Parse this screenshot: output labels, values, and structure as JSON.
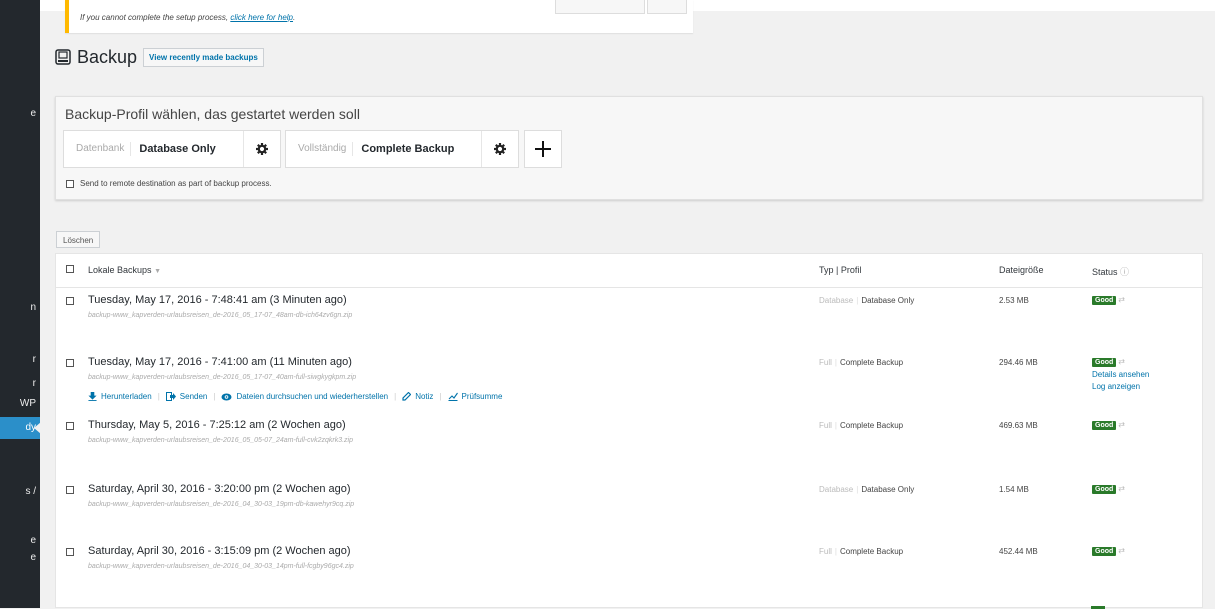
{
  "sidebar": {
    "visible_fragments": [
      "e",
      "n",
      "r",
      "r",
      "WP",
      "dy",
      "s /",
      "e",
      "e"
    ],
    "active_label": "dy"
  },
  "notice": {
    "text": "If you cannot complete the setup process, ",
    "link": "click here for help",
    "suffix": "."
  },
  "header": {
    "title": "Backup",
    "view_backups_button": "View recently made backups",
    "icon": "backup-icon"
  },
  "profiles": {
    "heading": "Backup-Profil wählen, das gestartet werden soll",
    "items": [
      {
        "type": "Datenbank",
        "name": "Database Only"
      },
      {
        "type": "Vollständig",
        "name": "Complete Backup"
      }
    ],
    "add_label": "+",
    "remote_checkbox_label": "Send to remote destination as part of backup process."
  },
  "delete_button": "Löschen",
  "table": {
    "columns": {
      "name": "Lokale Backups",
      "type": "Typ | Profil",
      "size": "Dateigröße",
      "status": "Status"
    },
    "rows": [
      {
        "title": "Tuesday, May 17, 2016 - 7:48:41 am (3 Minuten ago)",
        "file": "backup-www_kapverden-urlaubsreisen_de-2016_05_17-07_48am-db-ich64zv6gn.zip",
        "type": "Database",
        "profile": "Database Only",
        "size": "2.53 MB",
        "status": "Good"
      },
      {
        "title": "Tuesday, May 17, 2016 - 7:41:00 am (11 Minuten ago)",
        "file": "backup-www_kapverden-urlaubsreisen_de-2016_05_17-07_40am-full-siwgkygkpm.zip",
        "type": "Full",
        "profile": "Complete Backup",
        "size": "294.46 MB",
        "status": "Good"
      },
      {
        "title": "Thursday, May 5, 2016 - 7:25:12 am (2 Wochen ago)",
        "file": "backup-www_kapverden-urlaubsreisen_de-2016_05_05-07_24am-full-cvk2zqkrk3.zip",
        "type": "Full",
        "profile": "Complete Backup",
        "size": "469.63 MB",
        "status": "Good"
      },
      {
        "title": "Saturday, April 30, 2016 - 3:20:00 pm (2 Wochen ago)",
        "file": "backup-www_kapverden-urlaubsreisen_de-2016_04_30-03_19pm-db-kawehyr9cq.zip",
        "type": "Database",
        "profile": "Database Only",
        "size": "1.54 MB",
        "status": "Good"
      },
      {
        "title": "Saturday, April 30, 2016 - 3:15:09 pm (2 Wochen ago)",
        "file": "backup-www_kapverden-urlaubsreisen_de-2016_04_30-03_14pm-full-fcgby96gc4.zip",
        "type": "Full",
        "profile": "Complete Backup",
        "size": "452.44 MB",
        "status": "Good"
      }
    ],
    "row_actions": {
      "download": "Herunterladen",
      "send": "Senden",
      "browse": "Dateien durchsuchen und wiederherstellen",
      "note": "Notiz",
      "checksum": "Prüfsumme"
    },
    "status_links": {
      "details": "Details ansehen",
      "log": "Log anzeigen"
    }
  },
  "colors": {
    "accent": "#0073aa",
    "good": "#2a7a2a",
    "sidebar": "#23282d",
    "sidebar_active": "#2b8fc9",
    "notice_border": "#ffb900"
  }
}
